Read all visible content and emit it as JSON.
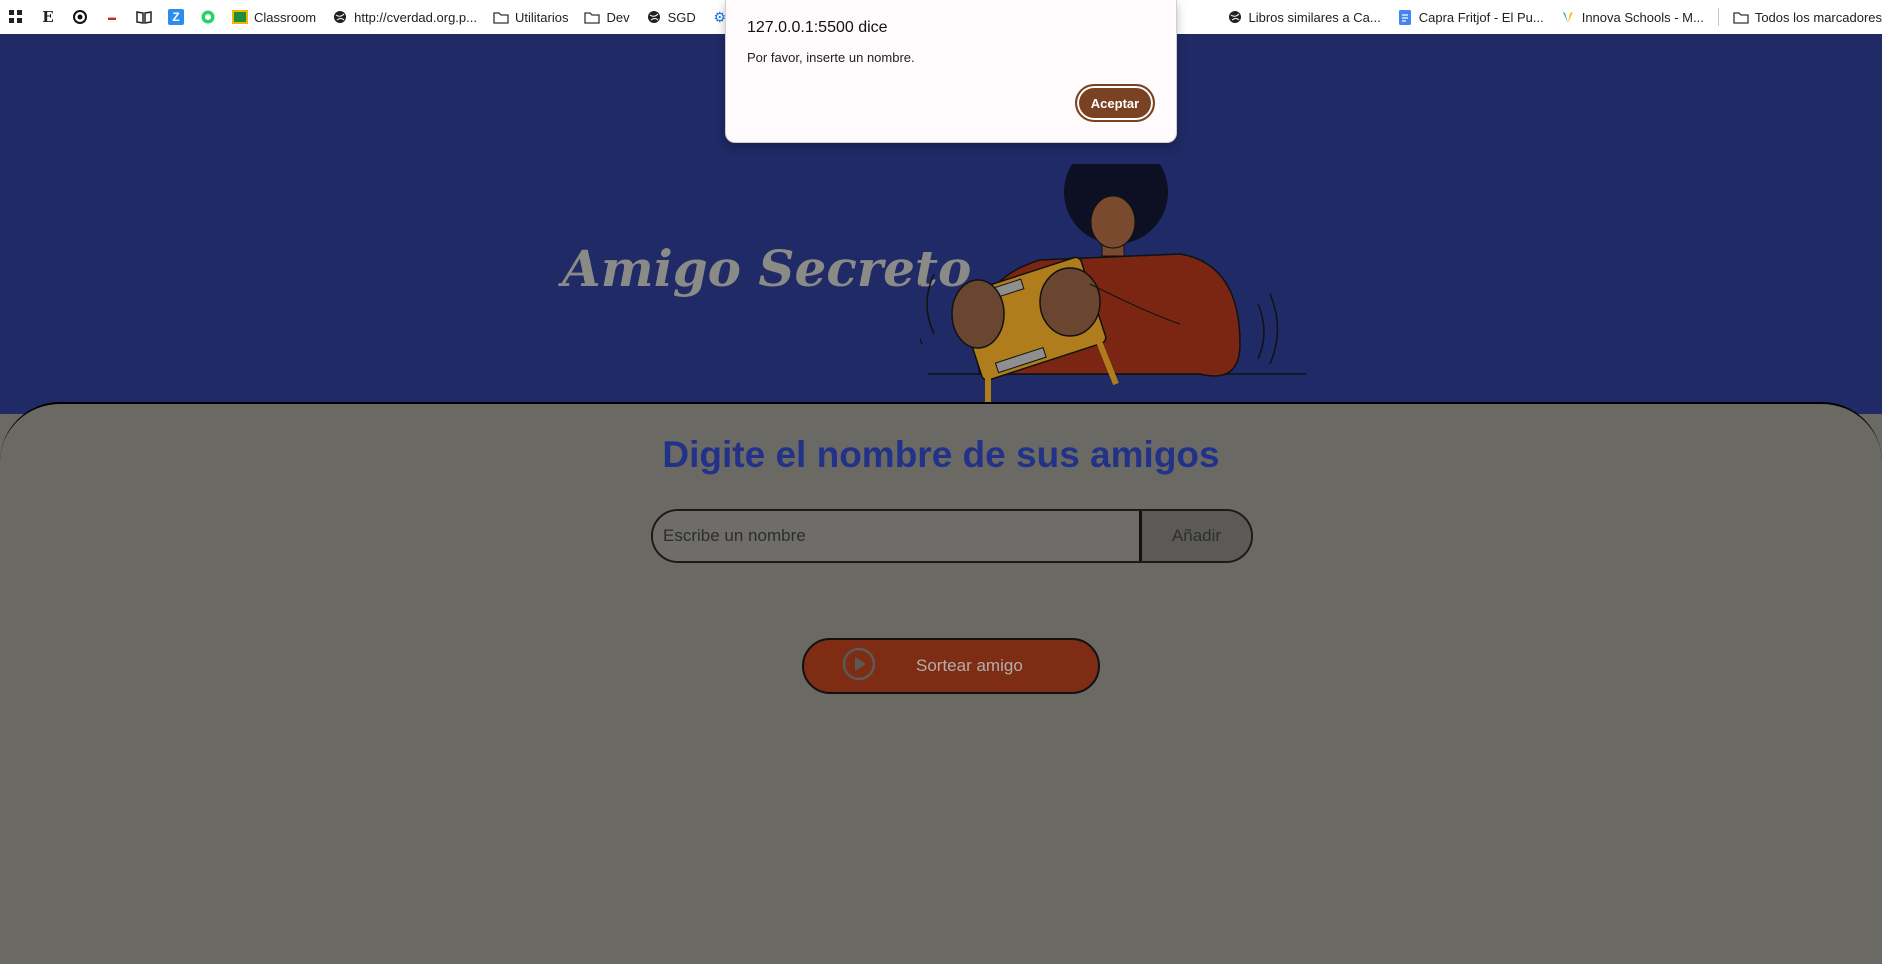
{
  "bookmarks": {
    "items": [
      {
        "label": "",
        "icon": "apps-grid-icon"
      },
      {
        "label": "",
        "icon": "e-icon"
      },
      {
        "label": "",
        "icon": "circle-dot-icon"
      },
      {
        "label": "",
        "icon": "red-logo-icon"
      },
      {
        "label": "",
        "icon": "book-icon"
      },
      {
        "label": "",
        "icon": "z-icon"
      },
      {
        "label": "",
        "icon": "whatsapp-icon"
      },
      {
        "label": "Classroom",
        "icon": "classroom-icon"
      },
      {
        "label": "http://cverdad.org.p...",
        "icon": "globe-icon"
      },
      {
        "label": "Utilitarios",
        "icon": "folder-icon"
      },
      {
        "label": "Dev",
        "icon": "folder-icon"
      },
      {
        "label": "SGD",
        "icon": "globe-icon"
      },
      {
        "label": "",
        "icon": "gear-icon"
      }
    ],
    "right_items": [
      {
        "label": "Libros similares a Ca...",
        "icon": "globe-icon"
      },
      {
        "label": "Capra Fritjof - El Pu...",
        "icon": "doc-icon"
      },
      {
        "label": "Innova Schools - M...",
        "icon": "leaf-icon"
      }
    ],
    "all_bookmarks": "Todos los marcadores"
  },
  "header": {
    "title": "Amigo Secreto"
  },
  "main": {
    "subtitle": "Digite el nombre de sus amigos",
    "input_placeholder": "Escribe un nombre",
    "add_label": "Añadir",
    "draw_label": "Sortear amigo"
  },
  "dialog": {
    "title": "127.0.0.1:5500 dice",
    "message": "Por favor, inserte un nombre.",
    "ok_label": "Aceptar"
  },
  "colors": {
    "header_bg": "#1f2a66",
    "panel_bg": "#6b6963",
    "accent_blue": "#233289",
    "draw_button": "#7e2d14",
    "dialog_ok": "#7a4222"
  }
}
